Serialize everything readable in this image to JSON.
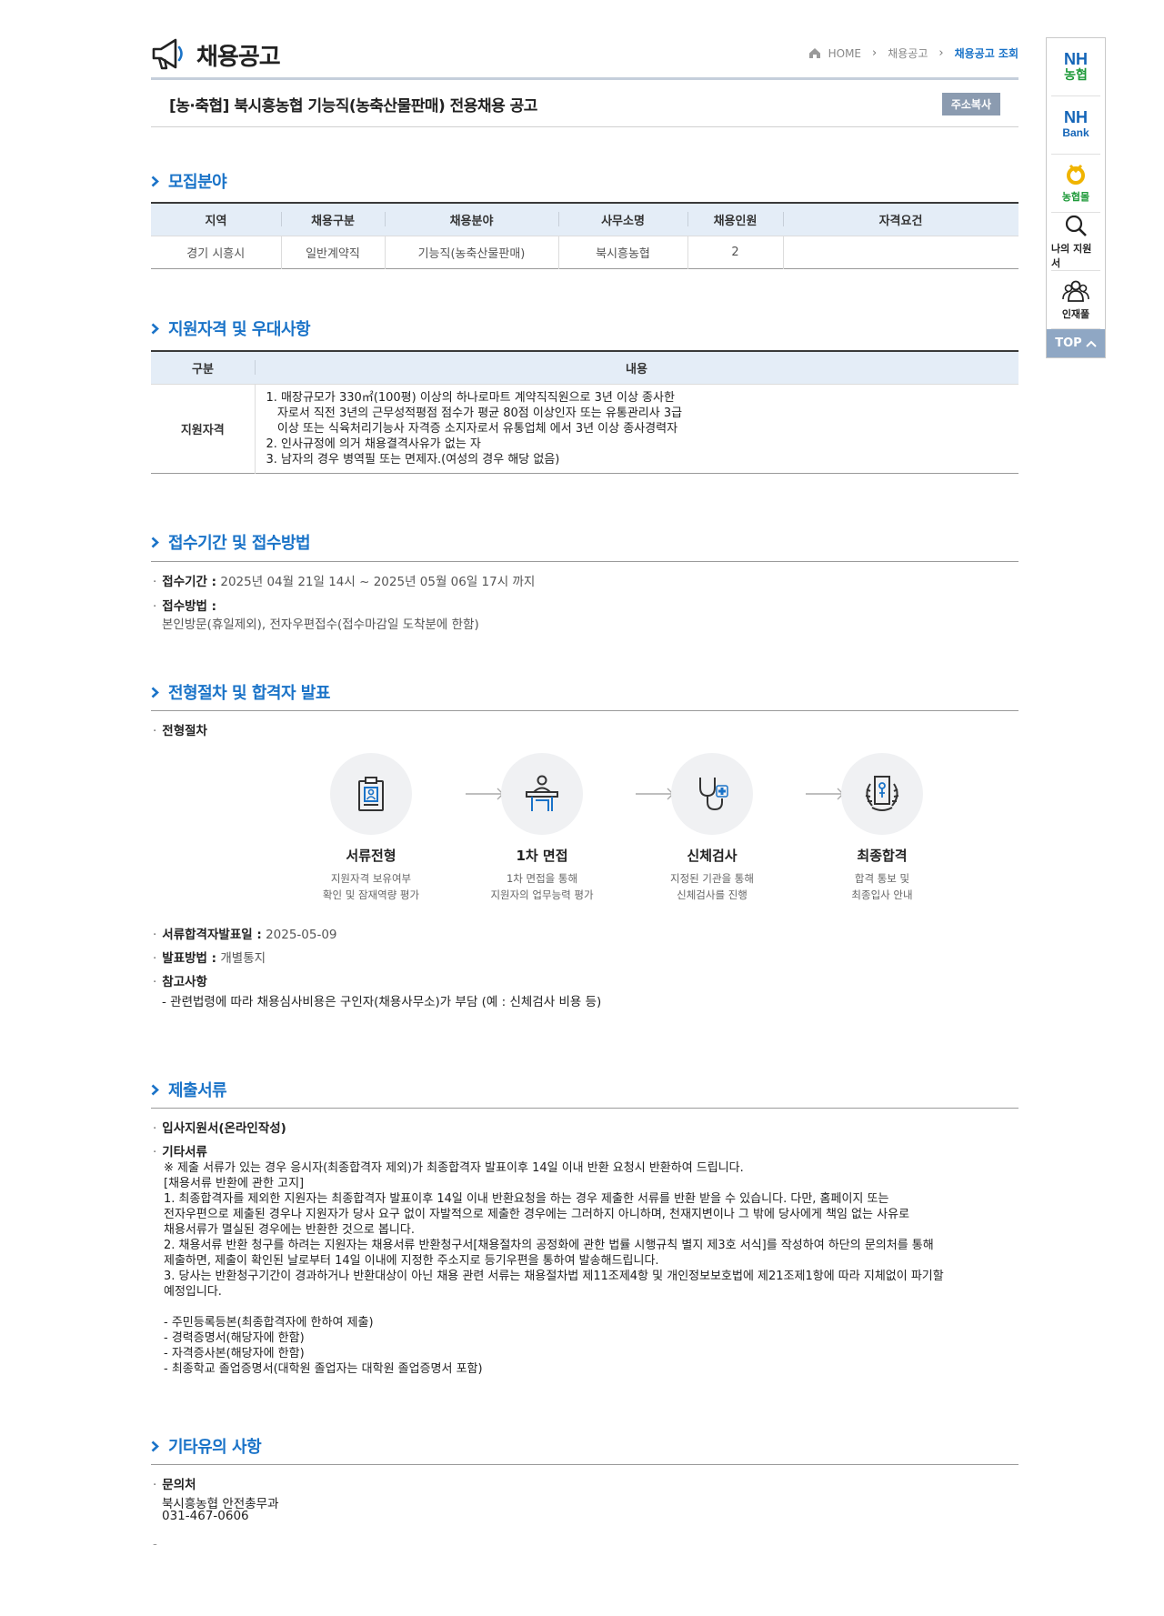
{
  "header": {
    "title": "채용공고",
    "breadcrumb": [
      "HOME",
      "채용공고",
      "채용공고 조회"
    ]
  },
  "post": {
    "title": "[농·축협] 북시흥농협 기능직(농축산물판매) 전용채용 공고",
    "copy_button": "주소복사"
  },
  "recruit": {
    "section_title": "모집분야",
    "columns": [
      "지역",
      "채용구분",
      "채용분야",
      "사무소명",
      "채용인원",
      "자격요건"
    ],
    "rows": [
      [
        "경기 시흥시",
        "일반계약직",
        "기능직(농축산물판매)",
        "북시흥농협",
        "2",
        ""
      ]
    ]
  },
  "qualification": {
    "section_title": "지원자격 및 우대사항",
    "columns": [
      "구분",
      "내용"
    ],
    "row_label": "지원자격",
    "lines": [
      "1. 매장규모가 330㎡(100평) 이상의 하나로마트 계약직직원으로 3년 이상 종사한",
      "   자로서 직전 3년의 근무성적평점 점수가 평균 80점 이상인자 또는 유통관리사 3급",
      "   이상 또는 식육처리기능사 자격증 소지자로서 유통업체 에서 3년 이상 종사경력자",
      "2. 인사규정에 의거 채용결격사유가 없는 자",
      "3. 남자의 경우 병역필 또는 면제자.(여성의 경우 해당 없음)"
    ]
  },
  "application": {
    "section_title": "접수기간 및 접수방법",
    "period_label": "접수기간 :",
    "period_value": "2025년 04월 21일 14시 ~ 2025년 05월 06일 17시 까지",
    "method_label": "접수방법 :",
    "method_value": "본인방문(휴일제외), 전자우편접수(접수마감일 도착분에 한함)"
  },
  "selection": {
    "section_title": "전형절차 및 합격자 발표",
    "process_label": "전형절차",
    "steps": [
      {
        "name": "서류전형",
        "desc": "지원자격 보유여부\n확인 및 잠재역량 평가",
        "icon": "document-icon"
      },
      {
        "name": "1차 면접",
        "desc": "1차 면접을 통해\n지원자의 업무능력 평가",
        "icon": "interview-icon"
      },
      {
        "name": "신체검사",
        "desc": "지정된 기관을 통해\n신체검사를 진행",
        "icon": "stethoscope-icon"
      },
      {
        "name": "최종합격",
        "desc": "합격 통보 및\n최종입사 안내",
        "icon": "laurel-certificate-icon"
      }
    ],
    "announce_label": "서류합격자발표일 :",
    "announce_value": "2025-05-09",
    "announce_method_label": "발표방법 :",
    "announce_method_value": "개별통지",
    "note_label": "참고사항",
    "note_value": "- 관련법령에 따라 채용심사비용은 구인자(채용사무소)가 부담 (예 : 신체검사 비용 등)"
  },
  "documents": {
    "section_title": "제출서류",
    "item1": "입사지원서(온라인작성)",
    "item2": "기타서류",
    "body": " ※ 제출 서류가 있는 경우 응시자(최종합격자 제외)가 최종합격자 발표이후 14일 이내 반환 요청시 반환하여 드립니다.\n[채용서류 반환에 관한 고지]\n 1. 최종합격자를 제외한 지원자는 최종합격자 발표이후 14일 이내 반환요청을 하는 경우 제출한 서류를 반환 받을 수 있습니다. 다만, 홈페이지 또는\n전자우편으로 제출된 경우나 지원자가 당사 요구 없이 자발적으로 제출한 경우에는 그러하지 아니하며, 천재지변이나 그 밖에 당사에게 책임 없는 사유로\n채용서류가 멸실된 경우에는 반환한 것으로 봅니다.\n 2. 채용서류 반환 청구를 하려는 지원자는 채용서류 반환청구서[채용절차의 공정화에 관한 법률 시행규칙 별지 제3호 서식]를 작성하여 하단의 문의처를 통해\n제출하면, 제출이 확인된 날로부터 14일 이내에 지정한 주소지로 등기우편을 통하여 발송해드립니다.\n 3. 당사는 반환청구기간이 경과하거나 반환대상이 아닌 채용 관련 서류는 채용절차법 제11조제4항 및 개인정보보호법에 제21조제1항에 따라 지체없이 파기할\n예정입니다.\n\n- 주민등록등본(최종합격자에 한하여 제출)\n- 경력증명서(해당자에 한함)\n- 자격증사본(해당자에 한함)\n- 최종학교 졸업증명서(대학원 졸업자는 대학원 졸업증명서 포함)"
  },
  "etc": {
    "section_title": "기타유의 사항",
    "contact_label": "문의처",
    "contact_lines": [
      "북시흥농협 안전총무과",
      "031-467-0606"
    ],
    "trailing": "-"
  },
  "quick_menu": {
    "nh_nonghyup_1": "NH",
    "nh_nonghyup_2": "농협",
    "nh_bank_1": "NH",
    "nh_bank_2": "Bank",
    "nhmall": "농협몰",
    "my_apply": "나의 지원서",
    "talent_pool": "인재풀",
    "top": "TOP"
  },
  "colors": {
    "accent": "#1a73c8",
    "table_header_bg": "#e4edf7",
    "copy_button_bg": "#8b9bb0",
    "top_button_bg": "#8fa7c4"
  }
}
